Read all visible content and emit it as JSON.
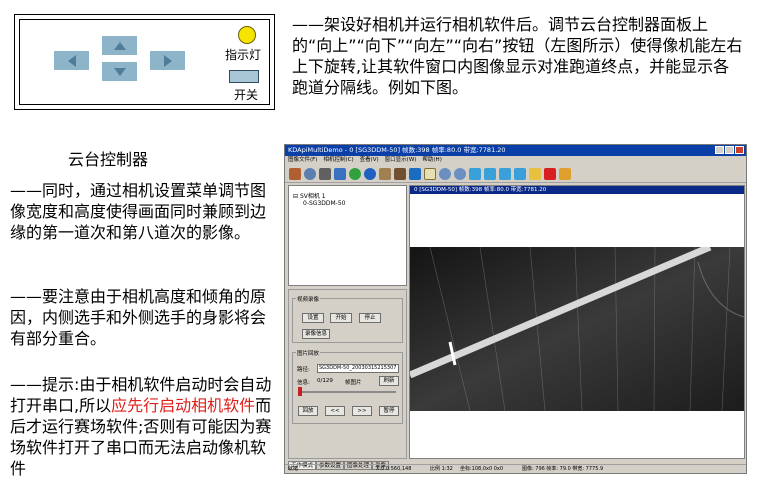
{
  "ptz_panel": {
    "indicator_label": "指示灯",
    "switch_label": "开关",
    "arrows": [
      "up",
      "down",
      "left",
      "right"
    ],
    "colors": {
      "button": "#8eb4c9",
      "arrow": "#4f7d98",
      "indicator": "#f5e400"
    },
    "caption": "云台控制器"
  },
  "paragraphs": {
    "intro": "——架设好相机并运行相机软件后。调节云台控制器面板上的“向上”“向下”“向左”“向右”按钮（左图所示）使得像机能左右上下旋转,让其软件窗口内图像显示对准跑道终点，并能显示各跑道分隔线。例如下图。",
    "p1": "——同时，通过相机设置菜单调节图像宽度和高度使得画面同时兼顾到边缘的第一道次和第八道次的影像。",
    "p2": "——要注意由于相机高度和倾角的原因，内侧选手和外侧选手的身影将会有部分重合。",
    "p3_start": "——提示:由于相机软件启动时会自动打开串口,所以",
    "p3_red": "应先行启动相机软件",
    "p3_end": "而后才运行赛场软件;否则有可能因为赛场软件打开了串口而无法启动像机软件",
    "red_color": "#e0201a"
  },
  "app": {
    "title": "KDApiMultiDemo - 0 [SG3DDM-50]  帧数:398  帧率:80.0  带宽:7781.20",
    "menu": [
      "图像文件(F)",
      "相机控制(C)",
      "查看(V)",
      "窗口显示(W)",
      "帮助(H)"
    ],
    "toolbar_icons": [
      "chart-icon",
      "zoom-icon",
      "camera-icon",
      "film-icon",
      "recycle-icon",
      "clock-icon",
      "save-icon",
      "print-icon",
      "monitor-icon",
      "page-icon",
      "zoom-in-icon",
      "zoom-out-icon",
      "arrow-left-icon",
      "arrow-right-icon",
      "arrow-up-icon",
      "arrow-down-icon",
      "folder-open-icon",
      "delete-icon",
      "edit-icon"
    ],
    "tree": {
      "root": "SV相机 1",
      "child": "0-SG3DDM-50"
    },
    "capture_group": {
      "title": "视频录像",
      "settings_button": "设置",
      "start_button": "开始",
      "stop_button": "停止",
      "info_button": "录像信息"
    },
    "playback_group": {
      "title": "图片回放",
      "path_label": "路径:",
      "path_value": "SG3DDM-50_20030315215307",
      "info_label": "信息:",
      "info_value": "0/129",
      "continuous_label": "帧图片",
      "refresh_button": "刷新",
      "playback_button": "回放",
      "prev_button": "<<",
      "next_button": ">>",
      "pause_button": "暂停"
    },
    "tabs": [
      "工作模式",
      "参数设置",
      "图像处理",
      "录像"
    ],
    "viewer_title": "0 [SG3DDM-50]  帧数:398  帧率:80.0  带宽:7781.20",
    "status": {
      "ready": "就绪",
      "coords": "X:0 0:560,148",
      "scale": "比例 1:32",
      "rgb": "坐标:108,0x0 0x0",
      "frame": "图像: 796  帧率: 79.0  带宽: 7775.9"
    }
  }
}
